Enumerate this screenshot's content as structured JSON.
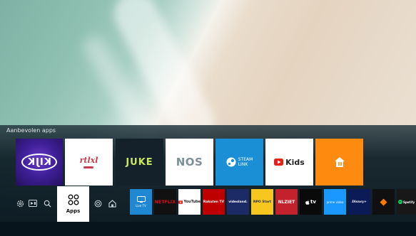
{
  "hub": {
    "recommended_title": "Aanbevolen apps",
    "recommended": [
      {
        "name": "KIJK",
        "label": "KIJK"
      },
      {
        "name": "RTL XL",
        "label": "rtlxl"
      },
      {
        "name": "JUKE",
        "label": "JUKE"
      },
      {
        "name": "NOS",
        "label": "NOS"
      },
      {
        "name": "Steam Link",
        "label_line1": "STEAM",
        "label_line2": "LINK"
      },
      {
        "name": "YouTube Kids",
        "label": "Kids"
      },
      {
        "name": "Thuisbezorgd",
        "label": ""
      }
    ],
    "nav": {
      "settings_icon": "gear-icon",
      "source_icon": "source-icon",
      "search_icon": "search-icon",
      "apps_label": "Apps",
      "ambient_icon": "ambient-icon",
      "home_icon": "home-icon"
    },
    "apps_row": [
      {
        "name": "Live TV",
        "label": "Live TV"
      },
      {
        "name": "Netflix",
        "label": "NETFLIX"
      },
      {
        "name": "YouTube",
        "label": "YouTube"
      },
      {
        "name": "Rakuten TV",
        "label": "Rakuten TV"
      },
      {
        "name": "Videoland",
        "label": "videoland."
      },
      {
        "name": "NPO Start",
        "label": "NPO Start"
      },
      {
        "name": "NLZIET",
        "label": "NLZIET"
      },
      {
        "name": "Apple TV",
        "label": "tv"
      },
      {
        "name": "Prime Video",
        "label": "prime video"
      },
      {
        "name": "Disney+",
        "label": "Disney+"
      },
      {
        "name": "Unknown orange app",
        "label": ""
      },
      {
        "name": "Spotify",
        "label": "Spotify"
      }
    ]
  }
}
